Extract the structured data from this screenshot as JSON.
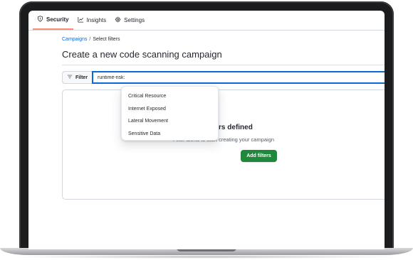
{
  "tabs": [
    {
      "label": "Security",
      "icon": "shield-icon",
      "active": true
    },
    {
      "label": "Insights",
      "icon": "graph-icon",
      "active": false
    },
    {
      "label": "Settings",
      "icon": "gear-icon",
      "active": false
    }
  ],
  "breadcrumb": {
    "link": "Campaigns",
    "separator": "/",
    "current": "Select filters"
  },
  "page_title": "Create a new code scanning campaign",
  "filter": {
    "button_label": "Filter",
    "input_value": "runtime-risk:"
  },
  "dropdown": {
    "options": [
      "Critical Resource",
      "Internet Exposed",
      "Lateral Movement",
      "Sensitive Data"
    ]
  },
  "empty_state": {
    "title": "No filters defined",
    "subtitle": "Filter alerts to start creating your campaign",
    "button_label": "Add filters"
  },
  "colors": {
    "accent_blue": "#0969da",
    "primary_green": "#1f883d",
    "active_tab_underline": "#fd8c73",
    "text": "#24292f",
    "muted_text": "#57606a"
  }
}
